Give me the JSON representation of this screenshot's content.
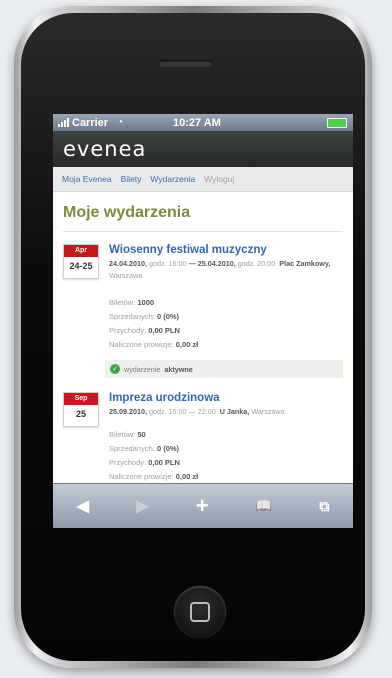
{
  "status_bar": {
    "carrier": "Carrier",
    "time": "10:27 AM"
  },
  "app": {
    "logo": "evenea"
  },
  "nav": {
    "items": [
      "Moja Evenea",
      "Bilety",
      "Wydarzenia",
      "Wyloguj"
    ]
  },
  "page_title": "Moje wydarzenia",
  "events": [
    {
      "date_month": "Apr",
      "date_day": "24-25",
      "title": "Wiosenny festiwal muzyczny",
      "date_range_start": "24.04.2010,",
      "time_start": "godz. 16:00",
      "date_range_end": "— 25.04.2010,",
      "time_end": "godz. 20:00",
      "venue": "Plac Zamkowy,",
      "city": "Warszawa",
      "stats": {
        "tickets_label": "Biletów:",
        "tickets": "1000",
        "sold_label": "Sprzedanych:",
        "sold": "0 (0%)",
        "income_label": "Przychody:",
        "income": "0,00 PLN",
        "fee_label": "Naliczone prowizje:",
        "fee": "0,00 zł"
      },
      "status_prefix": "wydarzenie",
      "status_value": "aktywne"
    },
    {
      "date_month": "Sep",
      "date_day": "25",
      "title": "Impreza urodzinowa",
      "date_range_start": "25.09.2010,",
      "time_start": "godz. 15:00",
      "date_range_end": "— 22:00",
      "venue": "U Janka,",
      "city": "Warszawa",
      "stats": {
        "tickets_label": "Biletów:",
        "tickets": "50",
        "sold_label": "Sprzedanych:",
        "sold": "0 (0%)",
        "income_label": "Przychody:",
        "income": "0,00 PLN",
        "fee_label": "Naliczone prowizje:",
        "fee": "0,00 zł"
      }
    }
  ],
  "toolbar": {
    "back": "◀",
    "forward": "▶",
    "add": "+",
    "bookmarks": "📖",
    "pages": "⧉"
  },
  "colors": {
    "accent_green": "#7a8d3a",
    "link_blue": "#3467b0",
    "date_red": "#c8191f"
  }
}
